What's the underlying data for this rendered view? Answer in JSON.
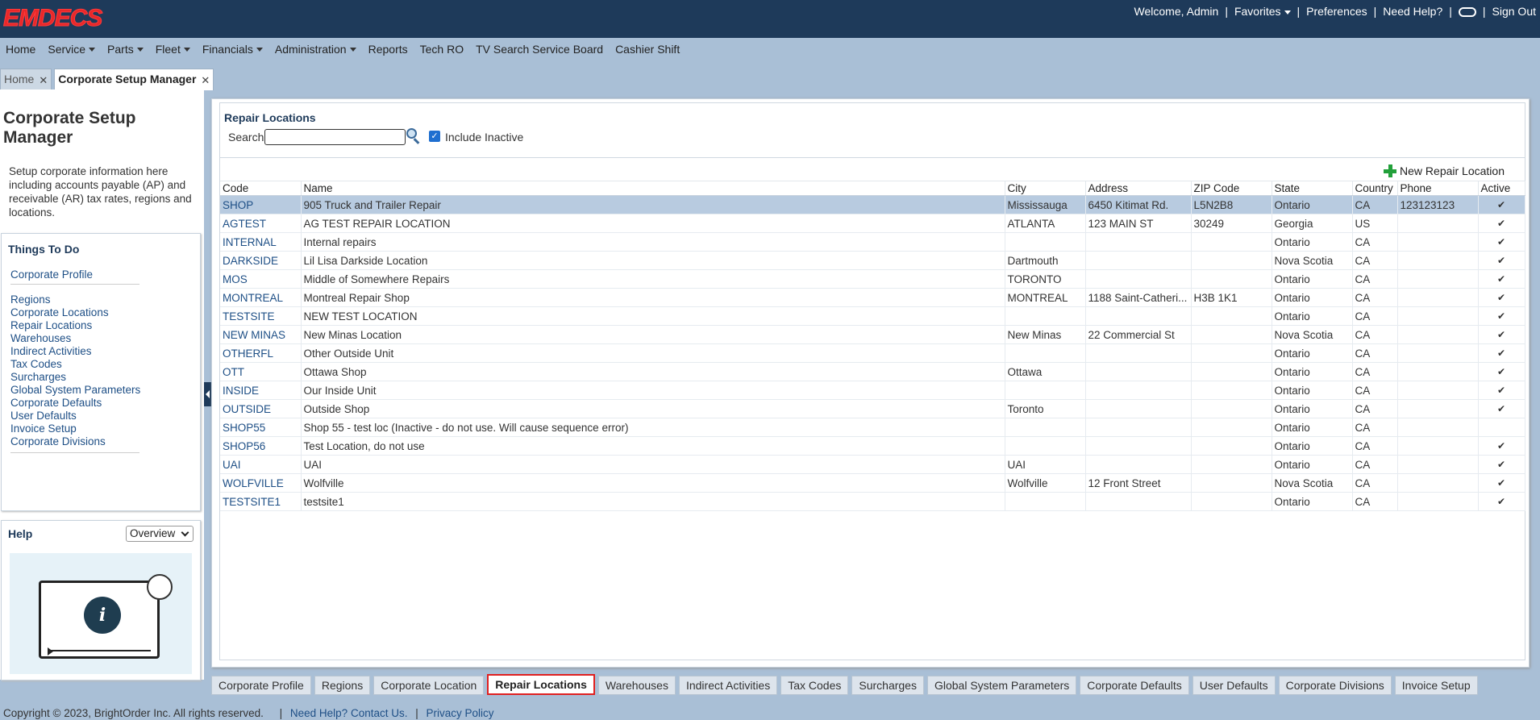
{
  "header": {
    "logo": "EMDECS",
    "welcome": "Welcome, Admin",
    "favorites": "Favorites",
    "preferences": "Preferences",
    "need_help": "Need Help?",
    "sign_out": "Sign Out"
  },
  "nav": [
    {
      "label": "Home",
      "dropdown": false
    },
    {
      "label": "Service",
      "dropdown": true
    },
    {
      "label": "Parts",
      "dropdown": true
    },
    {
      "label": "Fleet",
      "dropdown": true
    },
    {
      "label": "Financials",
      "dropdown": true
    },
    {
      "label": "Administration",
      "dropdown": true
    },
    {
      "label": "Reports",
      "dropdown": false
    },
    {
      "label": "Tech RO",
      "dropdown": false
    },
    {
      "label": "TV Search Service Board",
      "dropdown": false
    },
    {
      "label": "Cashier Shift",
      "dropdown": false
    }
  ],
  "doc_tabs": [
    {
      "label": "Home",
      "active": false
    },
    {
      "label": "Corporate Setup Manager",
      "active": true
    }
  ],
  "sidebar": {
    "title": "Corporate Setup Manager",
    "description": "Setup corporate information here including accounts payable (AP) and receivable (AR) tax rates, regions and locations.",
    "todo_title": "Things To Do",
    "top_link": "Corporate Profile",
    "links": [
      "Regions",
      "Corporate Locations",
      "Repair Locations",
      "Warehouses",
      "Indirect Activities",
      "Tax Codes",
      "Surcharges",
      "Global System Parameters",
      "Corporate Defaults",
      "User Defaults",
      "Invoice Setup",
      "Corporate Divisions"
    ],
    "help_title": "Help",
    "help_select": "Overview"
  },
  "main": {
    "title": "Repair Locations",
    "search_label": "Search:",
    "search_value": "",
    "include_inactive_label": "Include Inactive",
    "include_inactive_checked": true,
    "new_button": "New Repair Location",
    "columns": [
      "Code",
      "Name",
      "City",
      "Address",
      "ZIP Code",
      "State",
      "Country",
      "Phone",
      "Active"
    ],
    "rows": [
      {
        "code": "SHOP",
        "name": "905 Truck and Trailer Repair",
        "city": "Mississauga",
        "address": "6450 Kitimat Rd.",
        "zip": "L5N2B8",
        "state": "Ontario",
        "country": "CA",
        "phone": "123123123",
        "active": "✔",
        "selected": true
      },
      {
        "code": "AGTEST",
        "name": "AG TEST REPAIR LOCATION",
        "city": "ATLANTA",
        "address": "123 MAIN ST",
        "zip": "30249",
        "state": "Georgia",
        "country": "US",
        "phone": "",
        "active": "✔"
      },
      {
        "code": "INTERNAL",
        "name": "Internal repairs",
        "city": "",
        "address": "",
        "zip": "",
        "state": "Ontario",
        "country": "CA",
        "phone": "",
        "active": "✔"
      },
      {
        "code": "DARKSIDE",
        "name": "Lil Lisa Darkside Location",
        "city": "Dartmouth",
        "address": "",
        "zip": "",
        "state": "Nova Scotia",
        "country": "CA",
        "phone": "",
        "active": "✔"
      },
      {
        "code": "MOS",
        "name": "Middle of Somewhere Repairs",
        "city": "TORONTO",
        "address": "",
        "zip": "",
        "state": "Ontario",
        "country": "CA",
        "phone": "",
        "active": "✔"
      },
      {
        "code": "MONTREAL",
        "name": "Montreal Repair Shop",
        "city": "MONTREAL",
        "address": "1188 Saint-Catheri...",
        "zip": "H3B 1K1",
        "state": "Ontario",
        "country": "CA",
        "phone": "",
        "active": "✔"
      },
      {
        "code": "TESTSITE",
        "name": "NEW TEST LOCATION",
        "city": "",
        "address": "",
        "zip": "",
        "state": "Ontario",
        "country": "CA",
        "phone": "",
        "active": "✔"
      },
      {
        "code": "NEW MINAS",
        "name": "New Minas Location",
        "city": "New Minas",
        "address": "22 Commercial St",
        "zip": "",
        "state": "Nova Scotia",
        "country": "CA",
        "phone": "",
        "active": "✔"
      },
      {
        "code": "OTHERFL",
        "name": "Other Outside Unit",
        "city": "",
        "address": "",
        "zip": "",
        "state": "Ontario",
        "country": "CA",
        "phone": "",
        "active": "✔"
      },
      {
        "code": "OTT",
        "name": "Ottawa Shop",
        "city": "Ottawa",
        "address": "",
        "zip": "",
        "state": "Ontario",
        "country": "CA",
        "phone": "",
        "active": "✔"
      },
      {
        "code": "INSIDE",
        "name": "Our Inside Unit",
        "city": "",
        "address": "",
        "zip": "",
        "state": "Ontario",
        "country": "CA",
        "phone": "",
        "active": "✔"
      },
      {
        "code": "OUTSIDE",
        "name": "Outside Shop",
        "city": "Toronto",
        "address": "",
        "zip": "",
        "state": "Ontario",
        "country": "CA",
        "phone": "",
        "active": "✔"
      },
      {
        "code": "SHOP55",
        "name": "Shop 55 - test loc (Inactive - do not use. Will cause sequence error)",
        "city": "",
        "address": "",
        "zip": "",
        "state": "Ontario",
        "country": "CA",
        "phone": "",
        "active": ""
      },
      {
        "code": "SHOP56",
        "name": "Test Location, do not use",
        "city": "",
        "address": "",
        "zip": "",
        "state": "Ontario",
        "country": "CA",
        "phone": "",
        "active": "✔"
      },
      {
        "code": "UAI",
        "name": "UAI",
        "city": "UAI",
        "address": "",
        "zip": "",
        "state": "Ontario",
        "country": "CA",
        "phone": "",
        "active": "✔"
      },
      {
        "code": "WOLFVILLE",
        "name": "Wolfville",
        "city": "Wolfville",
        "address": "12 Front Street",
        "zip": "",
        "state": "Nova Scotia",
        "country": "CA",
        "phone": "",
        "active": "✔"
      },
      {
        "code": "TESTSITE1",
        "name": "testsite1",
        "city": "",
        "address": "",
        "zip": "",
        "state": "Ontario",
        "country": "CA",
        "phone": "",
        "active": "✔"
      }
    ]
  },
  "bottom_tabs": [
    {
      "label": "Corporate Profile",
      "active": false
    },
    {
      "label": "Regions",
      "active": false
    },
    {
      "label": "Corporate Location",
      "active": false
    },
    {
      "label": "Repair Locations",
      "active": true
    },
    {
      "label": "Warehouses",
      "active": false
    },
    {
      "label": "Indirect Activities",
      "active": false
    },
    {
      "label": "Tax Codes",
      "active": false
    },
    {
      "label": "Surcharges",
      "active": false
    },
    {
      "label": "Global System Parameters",
      "active": false
    },
    {
      "label": "Corporate Defaults",
      "active": false
    },
    {
      "label": "User Defaults",
      "active": false
    },
    {
      "label": "Corporate Divisions",
      "active": false
    },
    {
      "label": "Invoice Setup",
      "active": false
    }
  ],
  "footer": {
    "copyright": "Copyright © 2023, BrightOrder Inc. All rights reserved.",
    "help_link": "Need Help? Contact Us.",
    "privacy_link": "Privacy Policy"
  },
  "colors": {
    "header_bg": "#1e3a5a",
    "nav_bg": "#a9bfd6",
    "logo": "#e8282a",
    "selected_row": "#b8cbe0",
    "active_tab_border": "#e02020"
  }
}
